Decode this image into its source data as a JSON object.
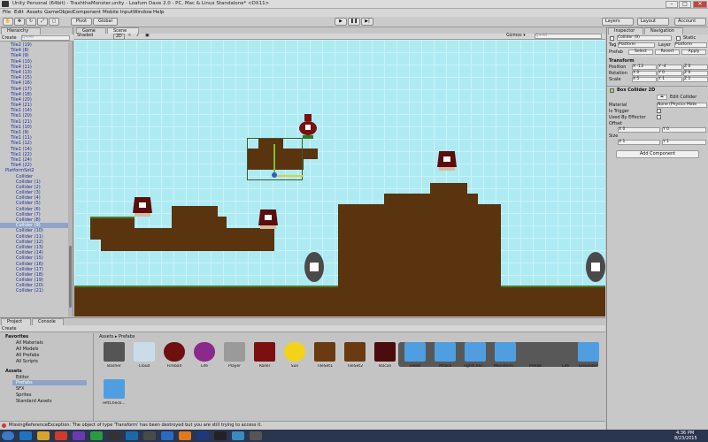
{
  "window": {
    "title": "Unity Personal (64bit) - TrashtheMonster.unity - Loafum Dave 2.0 - PC, Mac & Linux Standalone* <DX11>",
    "min": "–",
    "max": "□",
    "close": "✕"
  },
  "menu": [
    "File",
    "Edit",
    "Assets",
    "GameObject",
    "Component",
    "Mobile Input",
    "Window",
    "Help"
  ],
  "toolbar": {
    "pivot": "Pivot",
    "global": "Global",
    "play": "▶",
    "pause": "❚❚",
    "step": "▶|",
    "layers": "Layers",
    "layout": "Layout",
    "account": "Account"
  },
  "hierarchy": {
    "tab": "Hierarchy",
    "create": "Create",
    "search": "Q+All",
    "items": [
      "Tile2 (19)",
      "Tile4 (8)",
      "Tile4 (9)",
      "Tile4 (10)",
      "Tile4 (11)",
      "Tile4 (13)",
      "Tile4 (15)",
      "Tile4 (16)",
      "Tile4 (17)",
      "Tile4 (18)",
      "Tile4 (20)",
      "Tile4 (21)",
      "Tile1 (14)",
      "Tile1 (20)",
      "Tile1 (21)",
      "Tile1 (10)",
      "Tile1 (9)",
      "Tile1 (11)",
      "Tile1 (12)",
      "Tile1 (14)",
      "Tile1 (22)",
      "Tile1 (24)",
      "Tile4 (22)",
      "PlatformSet2",
      "Collider",
      "Collider (1)",
      "Collider (2)",
      "Collider (3)",
      "Collider (4)",
      "Collider (5)",
      "Collider (6)",
      "Collider (7)",
      "Collider (8)",
      "Collider (9)",
      "Collider (10)",
      "Collider (11)",
      "Collider (12)",
      "Collider (13)",
      "Collider (14)",
      "Collider (15)",
      "Collider (16)",
      "Collider (17)",
      "Collider (18)",
      "Collider (19)",
      "Collider (20)",
      "Collider (21)"
    ]
  },
  "scene": {
    "tab_game": "Game",
    "tab_scene": "Scene",
    "shaded": "Shaded",
    "mode2d": "2D",
    "gizmos": "Gizmos ▾",
    "search": "Q+All"
  },
  "inspector": {
    "tab": "Inspector",
    "tab2": "Navigation",
    "object_name": "Collider (9)",
    "static": "Static",
    "tag_label": "Tag",
    "tag": "Platform",
    "layer_label": "Layer",
    "layer": "Platform",
    "prefab_label": "Prefab",
    "select": "Select",
    "revert": "Revert",
    "apply": "Apply",
    "transform": "Transform",
    "position": "Position",
    "pos_x": "X -13",
    "pos_y": "Y -4",
    "pos_z": "Z 0",
    "rotation": "Rotation",
    "rot_x": "X 0",
    "rot_y": "Y 0",
    "rot_z": "Z 0",
    "scale": "Scale",
    "scl_x": "X 5",
    "scl_y": "Y 1",
    "scl_z": "Z 1",
    "box_collider": "Box Collider 2D",
    "edit_collider": "Edit Collider",
    "material": "Material",
    "material_val": "None (Physics Mate",
    "is_trigger": "Is Trigger",
    "used_by_effector": "Used By Effector",
    "offset": "Offset",
    "off_x": "X 0",
    "off_y": "Y 0",
    "size": "Size",
    "size_x": "X 1",
    "size_y": "Y 1",
    "add_component": "Add Component"
  },
  "project": {
    "tab": "Project",
    "tab2": "Console",
    "create": "Create",
    "favorites": "Favorites",
    "fav_items": [
      "All Materials",
      "All Models",
      "All Prefabs",
      "All Scripts"
    ],
    "assets": "Assets",
    "asset_folders": [
      "Editor",
      "Prefabs",
      "SFX",
      "Sprites",
      "Standard Assets"
    ],
    "breadcrumb": "Assets ▸ Prefabs",
    "items": [
      "Basher",
      "Cloud",
      "Fireball",
      "Life",
      "Player",
      "Roller",
      "Sun",
      "TileSet1",
      "TileSet2",
      "Volcan",
      "Head",
      "Attack",
      "rightChec...",
      "MonsterH...",
      "Prefab",
      "Life",
      "Grounded",
      "leftCheck..."
    ]
  },
  "console": {
    "message": "MissingReferenceException: The object of type 'Transform' has been destroyed but you are still trying to access it."
  },
  "taskbar": {
    "time": "4:36 PM",
    "date": "8/23/2015"
  }
}
